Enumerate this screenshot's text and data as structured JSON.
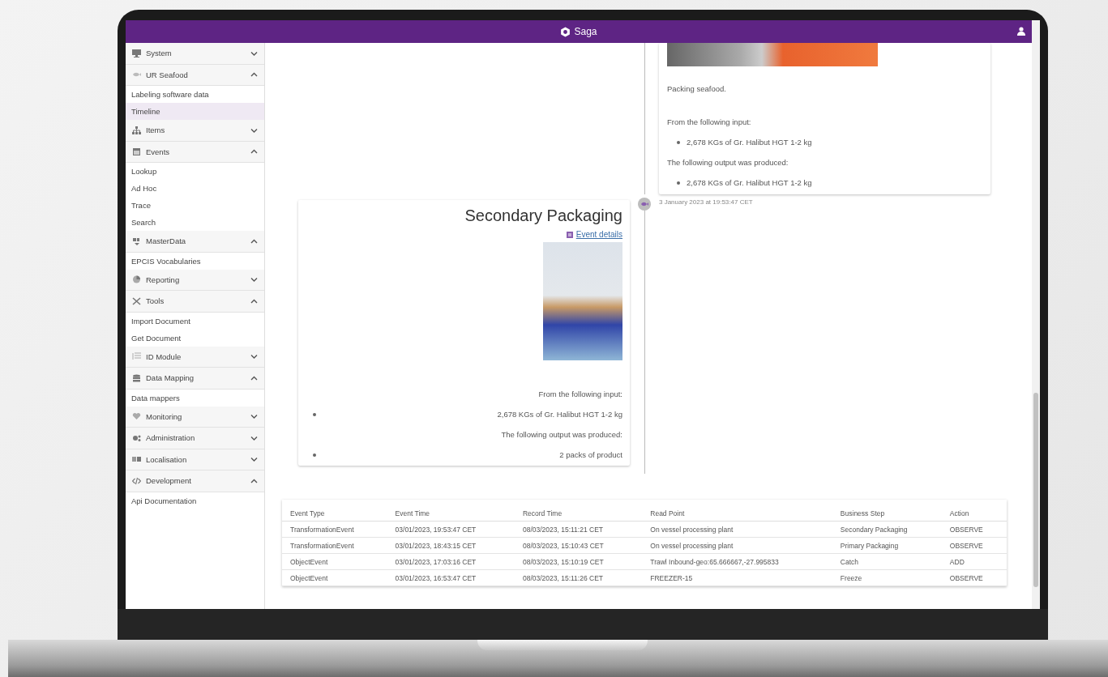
{
  "header": {
    "brand": "Saga"
  },
  "sidebar": {
    "groups": [
      {
        "label": "System",
        "expanded": false
      },
      {
        "label": "UR Seafood",
        "expanded": true,
        "children": [
          {
            "label": "Labeling software data",
            "selected": false
          },
          {
            "label": "Timeline",
            "selected": true
          }
        ]
      },
      {
        "label": "Items",
        "expanded": false
      },
      {
        "label": "Events",
        "expanded": true,
        "children": [
          {
            "label": "Lookup",
            "selected": false
          },
          {
            "label": "Ad Hoc",
            "selected": false
          },
          {
            "label": "Trace",
            "selected": false
          },
          {
            "label": "Search",
            "selected": false
          }
        ]
      },
      {
        "label": "MasterData",
        "expanded": true,
        "children": [
          {
            "label": "EPCIS Vocabularies",
            "selected": false
          }
        ]
      },
      {
        "label": "Reporting",
        "expanded": false
      },
      {
        "label": "Tools",
        "expanded": true,
        "children": [
          {
            "label": "Import Document",
            "selected": false
          },
          {
            "label": "Get Document",
            "selected": false
          }
        ]
      },
      {
        "label": "ID Module",
        "expanded": false
      },
      {
        "label": "Data Mapping",
        "expanded": true,
        "children": [
          {
            "label": "Data mappers",
            "selected": false
          }
        ]
      },
      {
        "label": "Monitoring",
        "expanded": false
      },
      {
        "label": "Administration",
        "expanded": false
      },
      {
        "label": "Localisation",
        "expanded": false
      },
      {
        "label": "Development",
        "expanded": true,
        "children": [
          {
            "label": "Api Documentation",
            "selected": false
          }
        ]
      }
    ]
  },
  "timeline": {
    "events": [
      {
        "kind": "right",
        "description": "Packing seafood.",
        "input_heading": "From the following input:",
        "inputs": [
          "2,678 KGs of Gr. Halibut HGT 1-2 kg"
        ],
        "output_heading": "The following output was produced:",
        "outputs": [
          "2,678 KGs of Gr. Halibut HGT 1-2 kg"
        ]
      },
      {
        "kind": "left",
        "title": "Secondary Packaging",
        "link": "Event details",
        "date": "3 January 2023 at 19:53:47 CET",
        "input_heading": "From the following input:",
        "inputs": [
          "2,678 KGs of Gr. Halibut HGT 1-2 kg"
        ],
        "output_heading": "The following output was produced:",
        "outputs": [
          "2 packs of product"
        ]
      }
    ]
  },
  "table": {
    "columns": [
      "Event Type",
      "Event Time",
      "Record Time",
      "Read Point",
      "Business Step",
      "Action"
    ],
    "rows": [
      [
        "TransformationEvent",
        "03/01/2023, 19:53:47 CET",
        "08/03/2023, 15:11:21 CET",
        "On vessel processing plant",
        "Secondary Packaging",
        "OBSERVE"
      ],
      [
        "TransformationEvent",
        "03/01/2023, 18:43:15 CET",
        "08/03/2023, 15:10:43 CET",
        "On vessel processing plant",
        "Primary Packaging",
        "OBSERVE"
      ],
      [
        "ObjectEvent",
        "03/01/2023, 17:03:16 CET",
        "08/03/2023, 15:10:19 CET",
        "Trawl Inbound-geo:65.666667,-27.995833",
        "Catch",
        "ADD"
      ],
      [
        "ObjectEvent",
        "03/01/2023, 16:53:47 CET",
        "08/03/2023, 15:11:26 CET",
        "FREEZER-15",
        "Freeze",
        "OBSERVE"
      ]
    ]
  }
}
